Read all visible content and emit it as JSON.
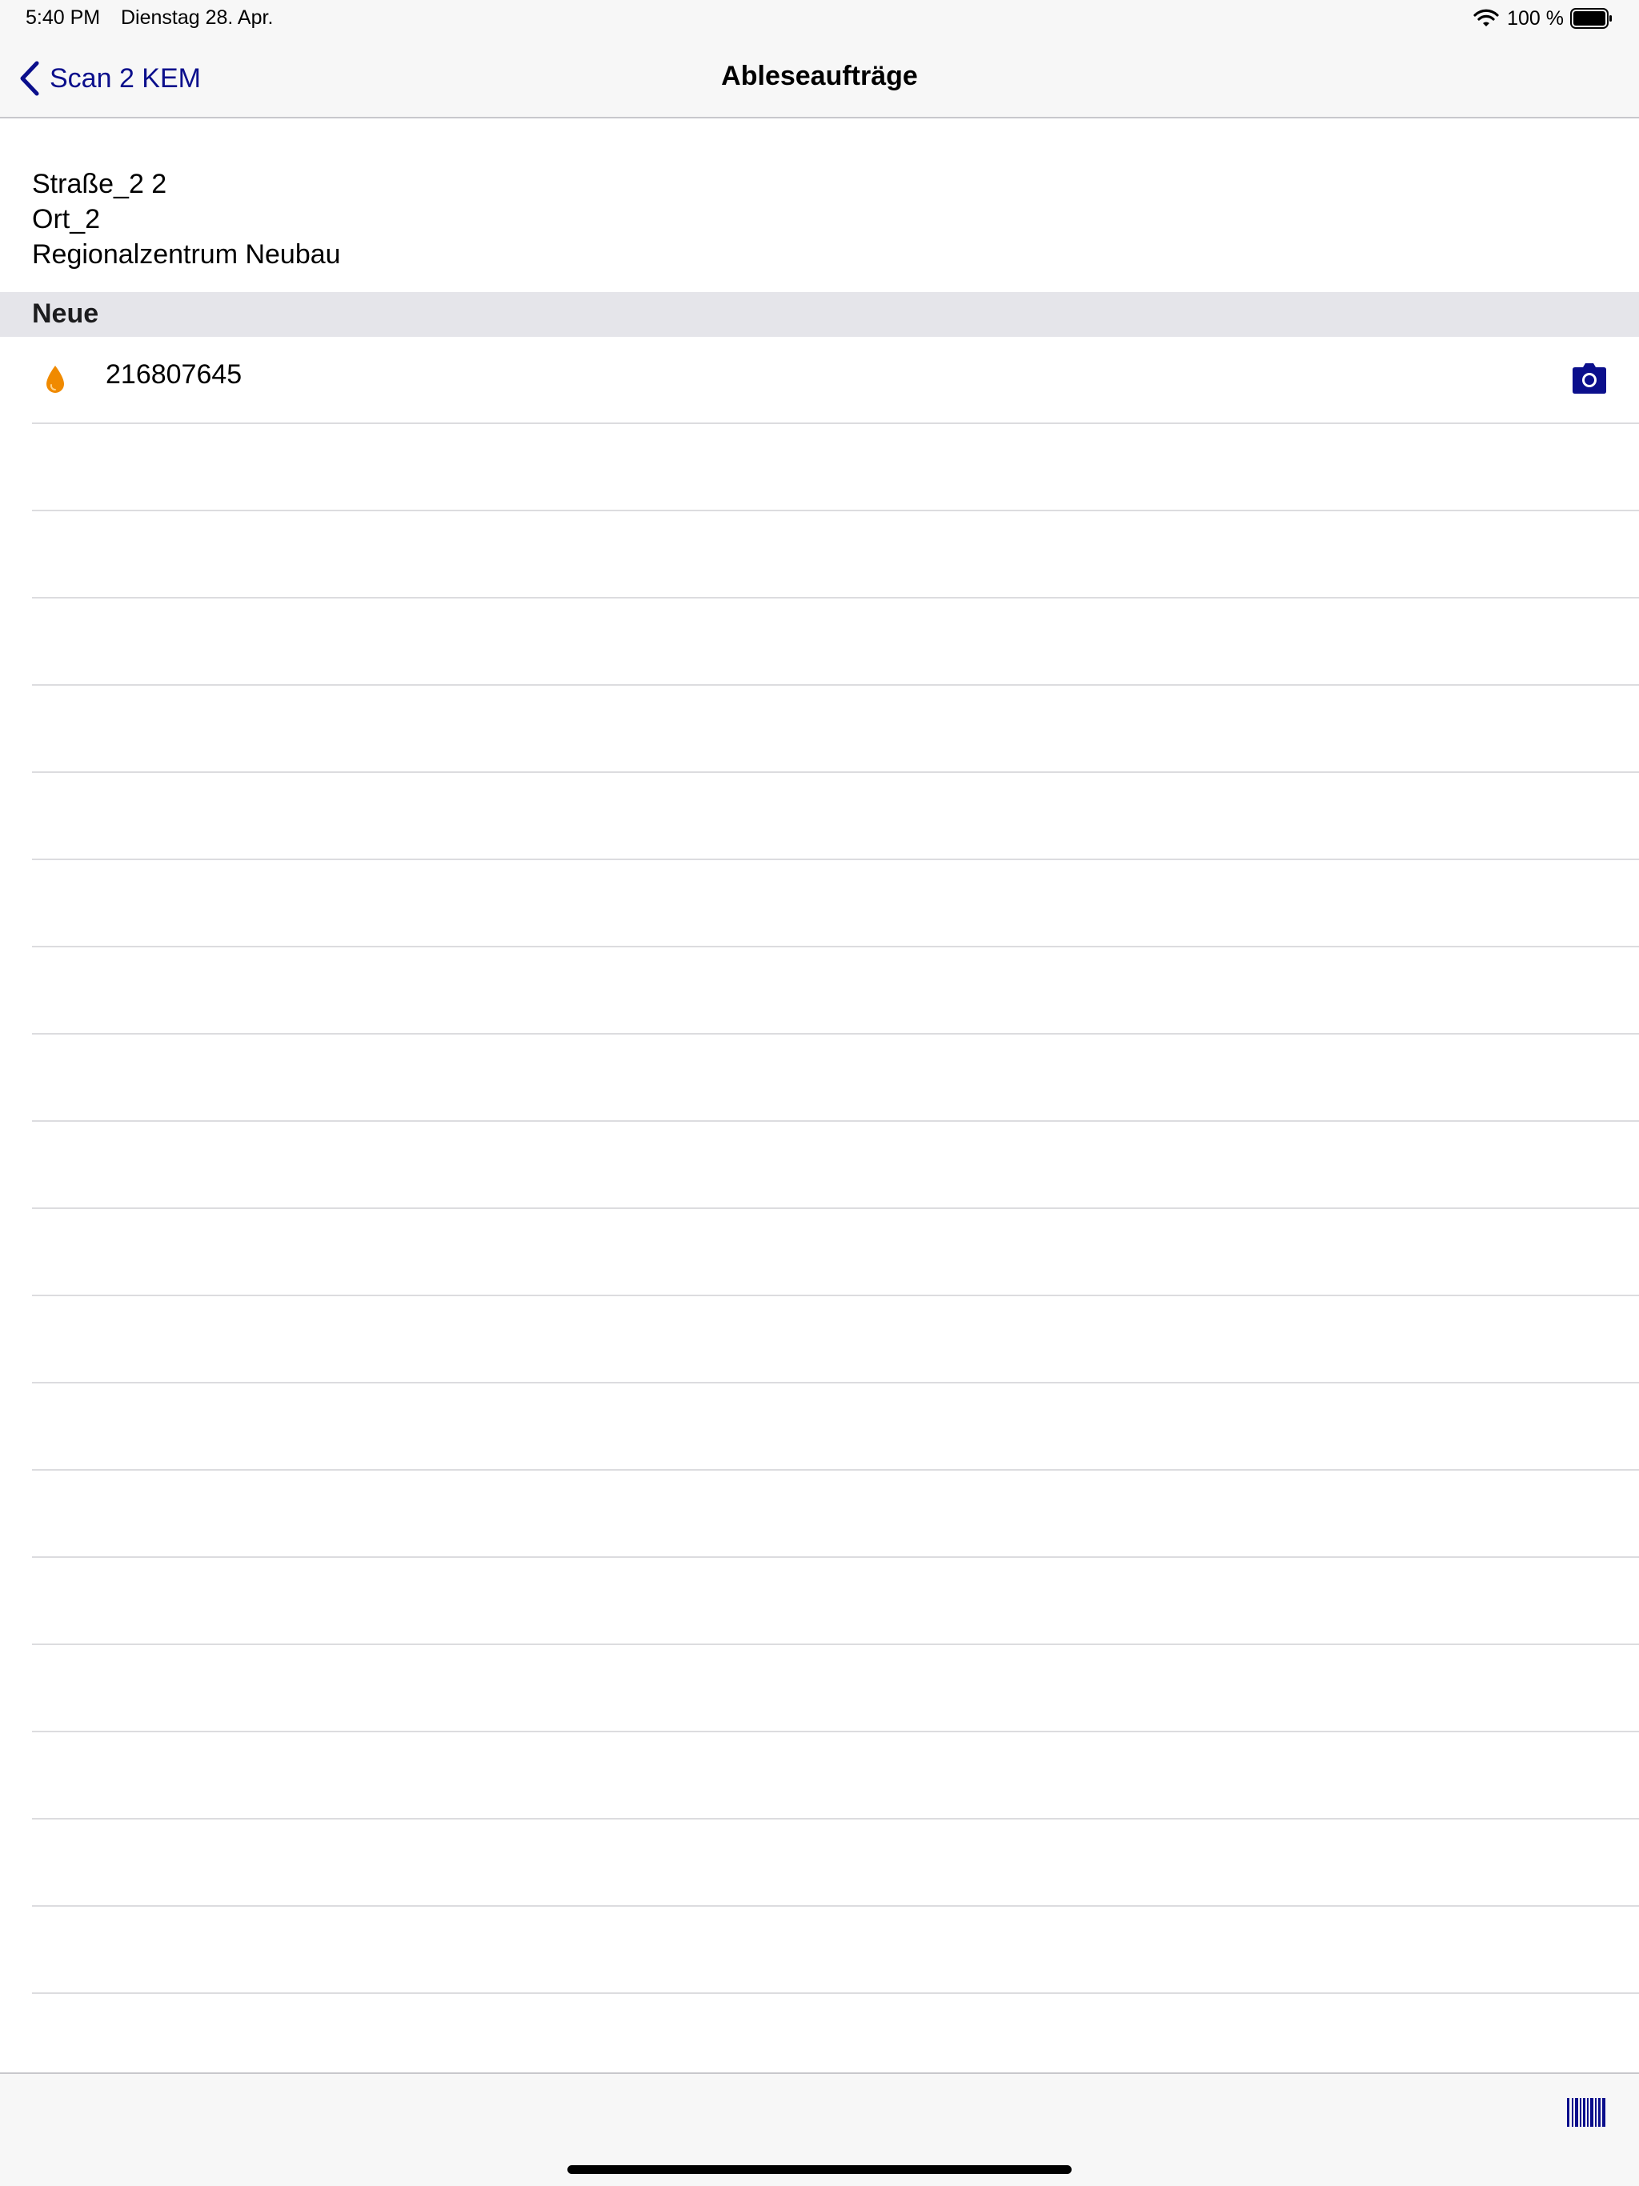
{
  "status_bar": {
    "time": "5:40 PM",
    "date": "Dienstag 28. Apr.",
    "battery_text": "100 %",
    "icons": [
      "wifi-icon",
      "battery-icon"
    ]
  },
  "nav": {
    "back_label": "Scan 2 KEM",
    "title": "Ableseaufträge",
    "back_icon": "chevron-back-icon"
  },
  "address": {
    "street": "Straße_2 2",
    "city": "Ort_2",
    "region": "Regionalzentrum Neubau"
  },
  "section": {
    "title": "Neue"
  },
  "orders": [
    {
      "meter_number": "216807645",
      "type_icon": "water-drop-icon",
      "action_icon": "camera-icon"
    }
  ],
  "empty_row_count": 18,
  "toolbar": {
    "action_icon": "barcode-icon"
  },
  "colors": {
    "accent": "#0b0f8c",
    "drop": "#f08a00",
    "bar_background": "#f7f7f7",
    "section_background": "#e5e5ea",
    "separator": "#dcdcdf"
  }
}
